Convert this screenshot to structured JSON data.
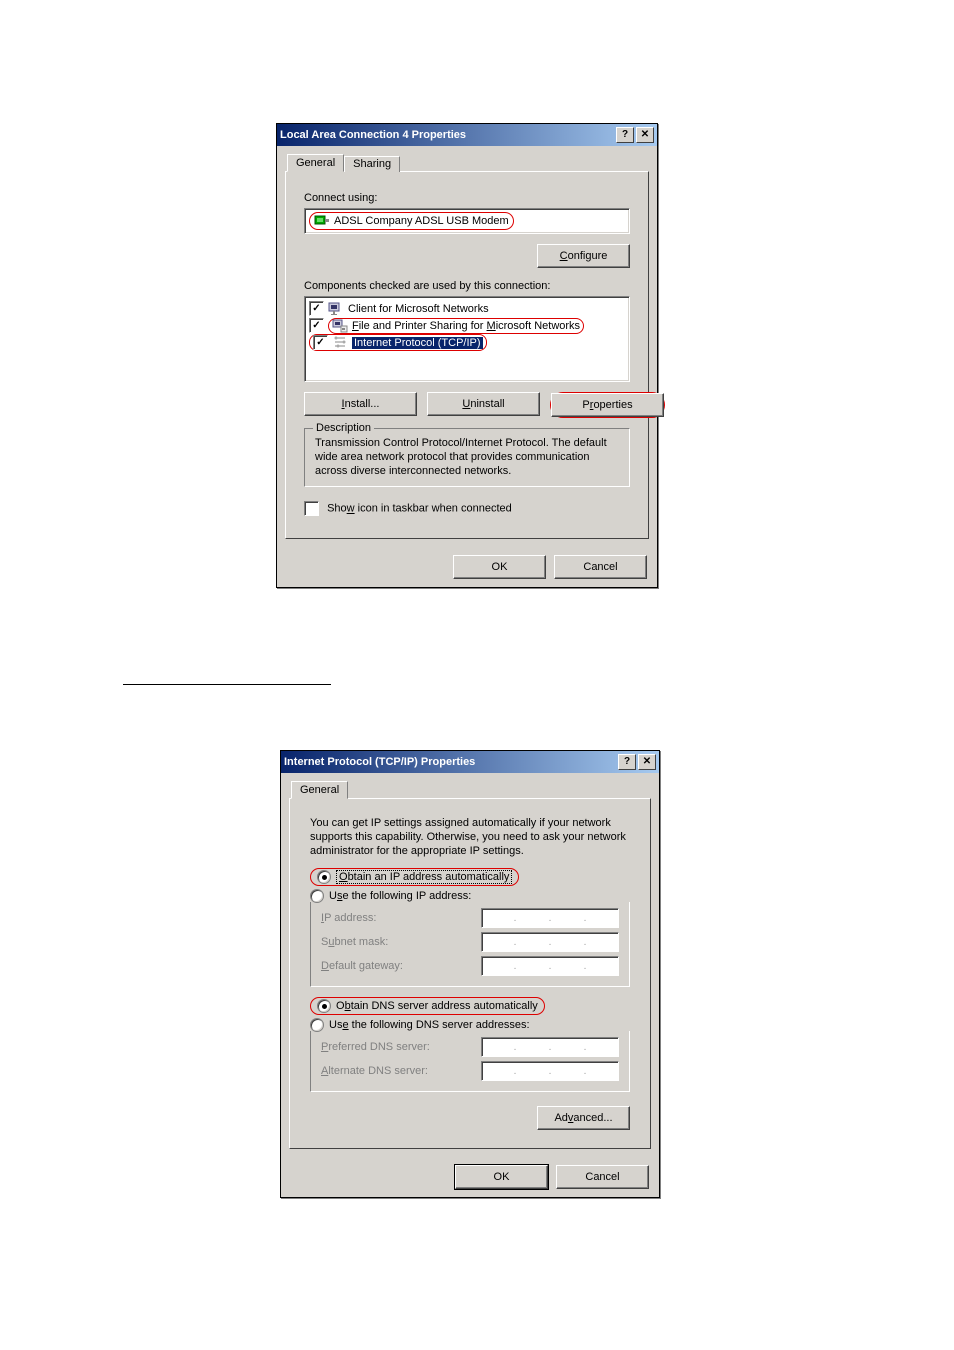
{
  "dlg1": {
    "title": "Local Area Connection 4 Properties",
    "tabs": {
      "general": "General",
      "sharing": "Sharing"
    },
    "connect_using_label": "Connect using:",
    "adapter": "ADSL Company ADSL USB Modem",
    "configure_btn": "Configure",
    "components_label": "Components checked are used by this connection:",
    "items": [
      {
        "label": "Client for Microsoft Networks",
        "checked": true
      },
      {
        "label": "File and Printer Sharing for Microsoft Networks",
        "checked": true
      },
      {
        "label": "Internet Protocol (TCP/IP)",
        "checked": true,
        "selected": true
      }
    ],
    "install_btn": "Install...",
    "uninstall_btn": "Uninstall",
    "properties_btn": "Properties",
    "desc_legend": "Description",
    "desc_text": "Transmission Control Protocol/Internet Protocol. The default wide area network protocol that provides communication across diverse interconnected networks.",
    "show_icon": "Show icon in taskbar when connected",
    "ok": "OK",
    "cancel": "Cancel"
  },
  "dlg2": {
    "title": "Internet Protocol (TCP/IP) Properties",
    "tab_general": "General",
    "intro": "You can get IP settings assigned automatically if your network supports this capability. Otherwise, you need to ask your network administrator for the appropriate IP settings.",
    "opt_auto_ip": "Obtain an IP address automatically",
    "opt_manual_ip": "Use the following IP address:",
    "ip_address": "IP address:",
    "subnet_mask": "Subnet mask:",
    "default_gateway": "Default gateway:",
    "opt_auto_dns": "Obtain DNS server address automatically",
    "opt_manual_dns": "Use the following DNS server addresses:",
    "pref_dns": "Preferred DNS server:",
    "alt_dns": "Alternate DNS server:",
    "advanced": "Advanced...",
    "ok": "OK",
    "cancel": "Cancel"
  }
}
